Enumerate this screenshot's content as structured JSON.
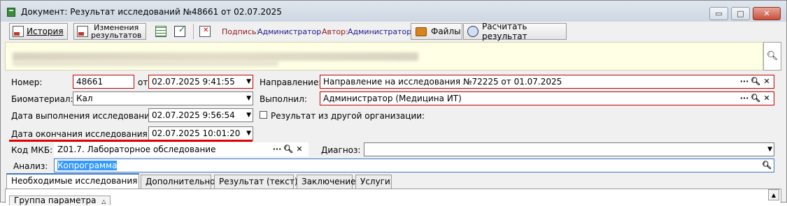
{
  "window": {
    "title": "Документ: Результат исследований №48661 от 02.07.2025",
    "controls": {
      "minimize": "▭",
      "maximize": "□",
      "close": "✕"
    }
  },
  "toolbar": {
    "history": "История",
    "change_results_line1": "Изменения",
    "change_results_line2": "результатов",
    "signature_label": "Подпись:",
    "signature_value": "Администратор",
    "author_label": "Автор:",
    "author_value": "Администратор",
    "files": "Файлы",
    "calculate": "Расчитать результат"
  },
  "form": {
    "number_label": "Номер:",
    "number_value": "48661",
    "from_label": "от",
    "date_value": "02.07.2025 9:41:55",
    "direction_label": "Направление:",
    "direction_value": "Направление на исследования №72225 от 01.07.2025",
    "biomaterial_label": "Биоматериал:",
    "biomaterial_value": "Кал",
    "performed_label": "Выполнил:",
    "performed_value": "Администратор (Медицина ИТ)",
    "exec_date_label": "Дата выполнения исследования:",
    "exec_date_value": "02.07.2025 9:56:54",
    "other_org_label": "Результат из другой организации:",
    "end_date_label": "Дата окончания исследования:",
    "end_date_value": "02.07.2025 10:01:20",
    "mkb_label": "Код МКБ:",
    "mkb_value": "Z01.7. Лабораторное обследование",
    "diagnosis_label": "Диагноз:",
    "diagnosis_value": "",
    "analysis_label": "Анализ:",
    "analysis_value": "Копрограмма"
  },
  "tabs": [
    {
      "label": "Необходимые исследования",
      "active": true
    },
    {
      "label": "Дополнительно",
      "active": false
    },
    {
      "label": "Результат (текст)",
      "active": false
    },
    {
      "label": "Заключение",
      "active": false
    },
    {
      "label": "Услуги",
      "active": false
    }
  ],
  "table": {
    "column_group": "Группа параметра"
  },
  "colors": {
    "error_border": "#c00000",
    "highlight_underline": "#e00000",
    "signature_text": "#1a1a8c",
    "author_text": "#8c1a1a"
  }
}
